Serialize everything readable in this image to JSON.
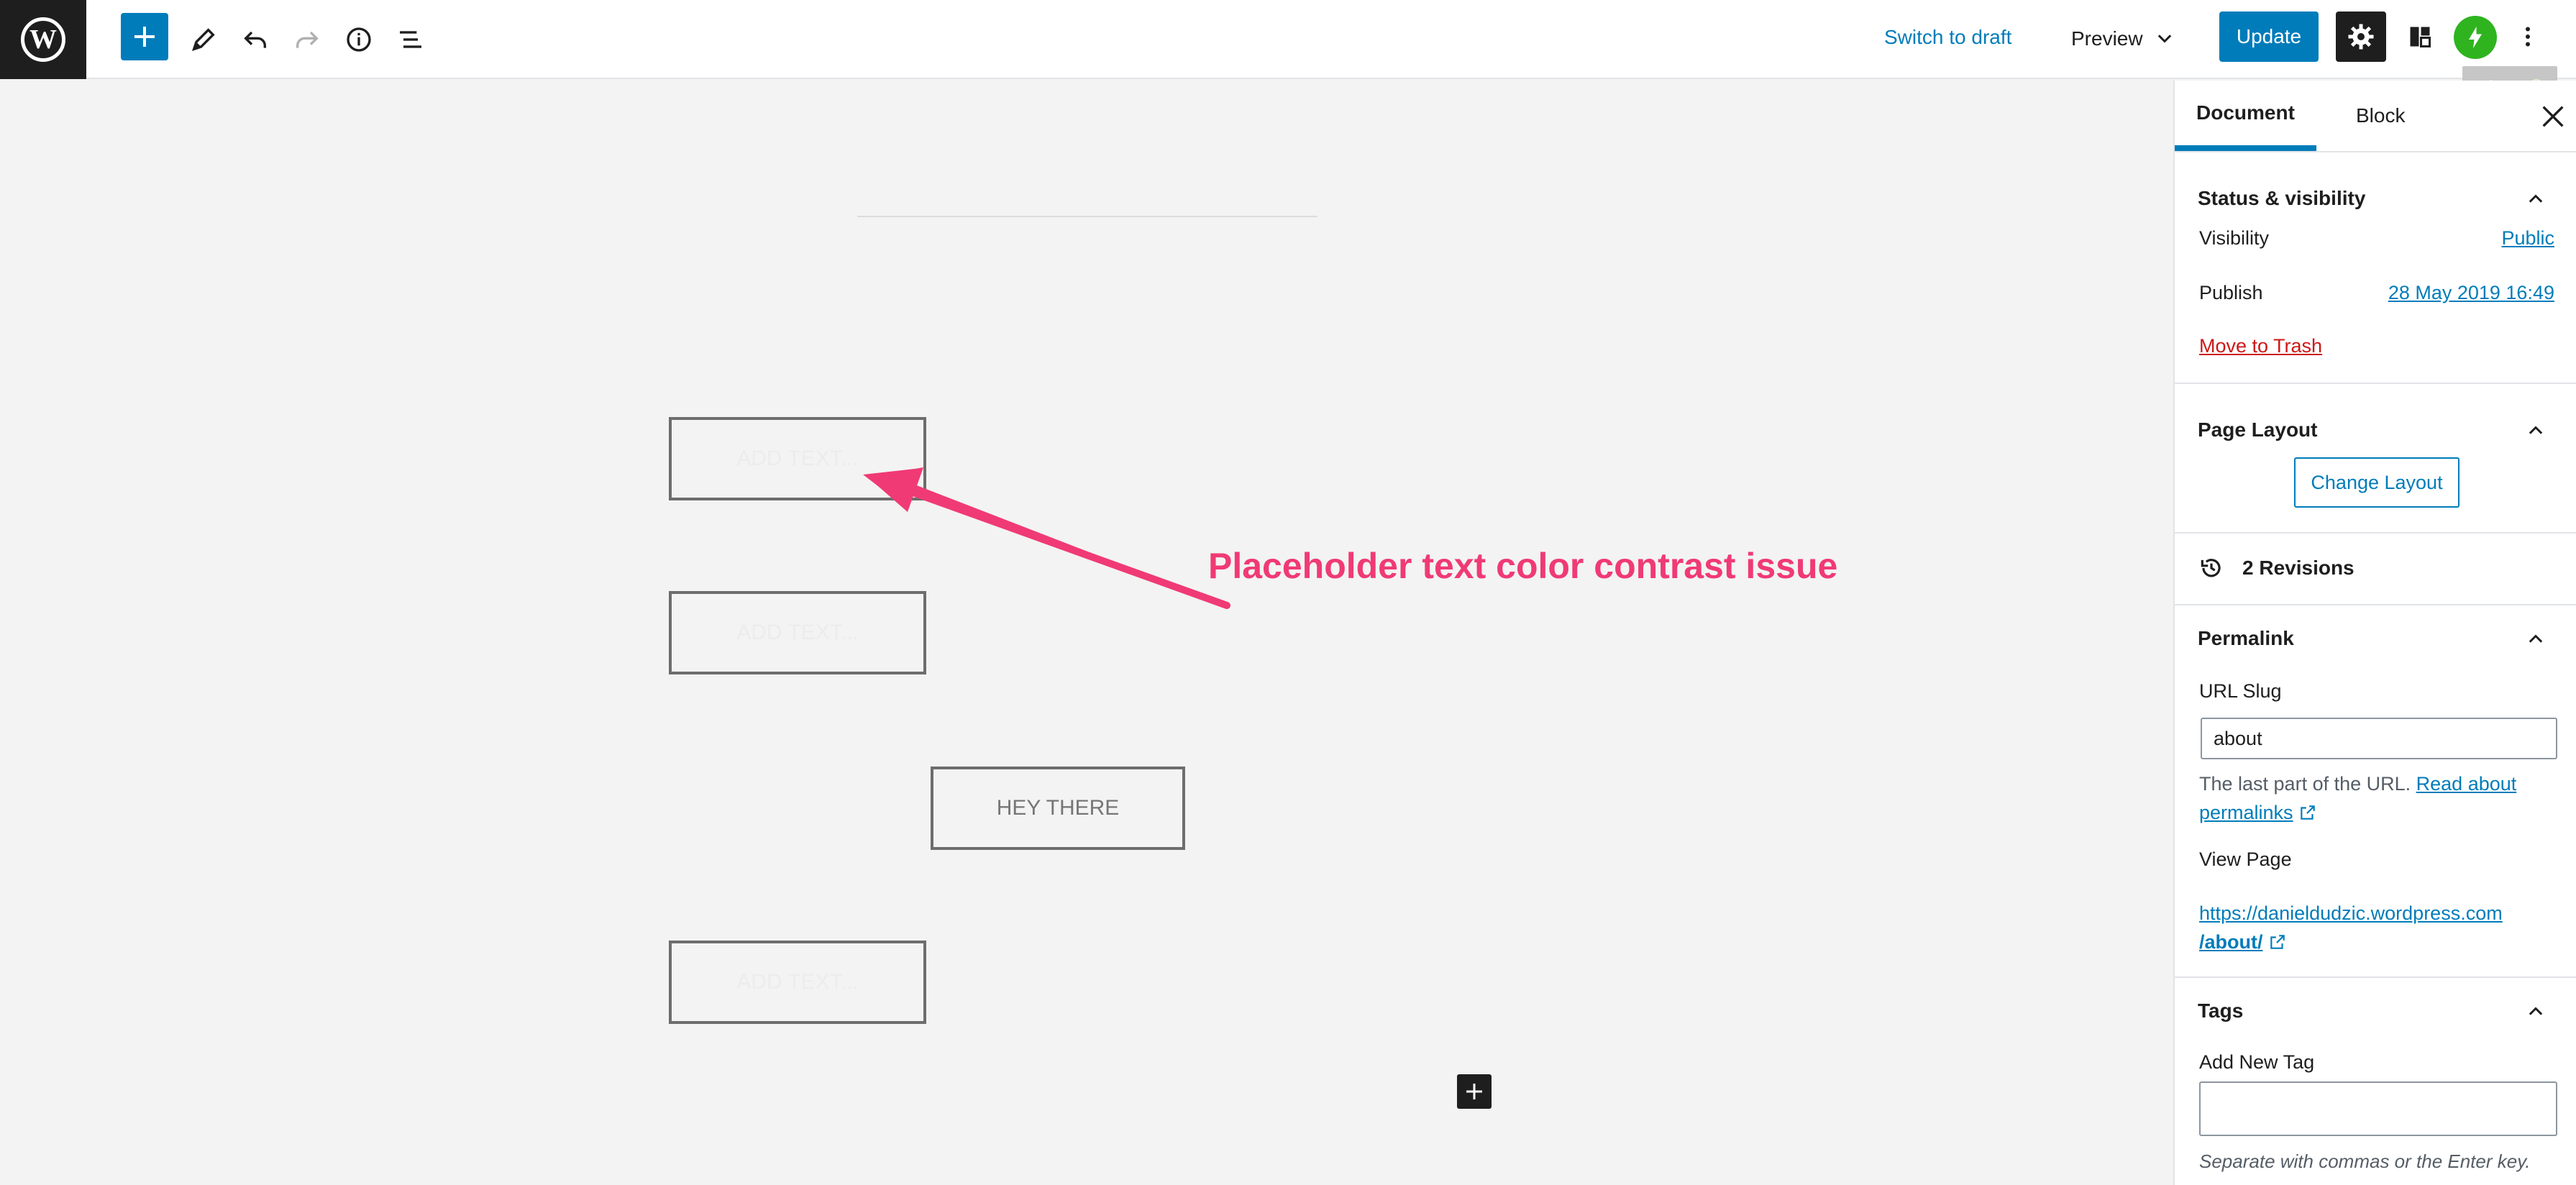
{
  "toolbar": {
    "logo": "W",
    "switch_to_draft": "Switch to draft",
    "preview": "Preview",
    "update": "Update"
  },
  "canvas": {
    "placeholder_1": "ADD TEXT...",
    "placeholder_2": "ADD TEXT...",
    "button_text": "HEY THERE",
    "placeholder_3": "ADD TEXT...",
    "annotation": "Placeholder text color contrast issue",
    "annotation_color": "#f03a75"
  },
  "sidebar": {
    "tab_document": "Document",
    "tab_block": "Block",
    "status": {
      "title": "Status & visibility",
      "visibility_label": "Visibility",
      "visibility_value": "Public",
      "publish_label": "Publish",
      "publish_value": "28 May 2019 16:49",
      "trash": "Move to Trash"
    },
    "layout": {
      "title": "Page Layout",
      "button": "Change Layout"
    },
    "revisions": "2 Revisions",
    "permalink": {
      "title": "Permalink",
      "slug_label": "URL Slug",
      "slug_value": "about",
      "help_prefix": "The last part of the URL.",
      "help_link_1": "Read about",
      "help_link_2": "permalinks",
      "view_label": "View Page",
      "url_line_1": "https://danieldudzic.wordpress.com",
      "url_line_2": "/about/"
    },
    "tags": {
      "title": "Tags",
      "add_label": "Add New Tag",
      "help": "Separate with commas or the Enter key."
    }
  },
  "colors": {
    "accent": "#007cba",
    "trash": "#cc1818",
    "jetpack": "#2fb41f"
  }
}
